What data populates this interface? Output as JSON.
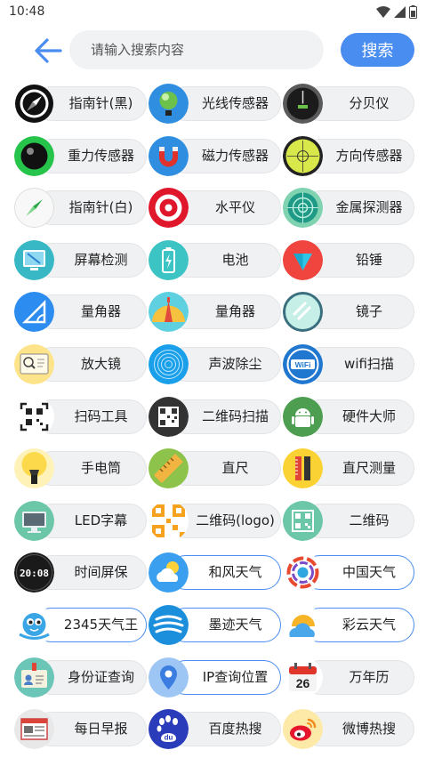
{
  "status": {
    "time": "10:48"
  },
  "search": {
    "placeholder": "请输入搜索内容",
    "value": "",
    "button_label": "搜索"
  },
  "colors": {
    "accent": "#4a8df0",
    "pill": "#f0f1f3"
  },
  "tools": [
    {
      "label": "指南针(黑)",
      "icon": "compass-black-icon"
    },
    {
      "label": "光线传感器",
      "icon": "light-sensor-icon"
    },
    {
      "label": "分贝仪",
      "icon": "decibel-meter-icon"
    },
    {
      "label": "重力传感器",
      "icon": "gravity-sensor-icon"
    },
    {
      "label": "磁力传感器",
      "icon": "magnet-icon"
    },
    {
      "label": "方向传感器",
      "icon": "orientation-sensor-icon"
    },
    {
      "label": "指南针(白)",
      "icon": "compass-white-icon"
    },
    {
      "label": "水平仪",
      "icon": "level-target-icon"
    },
    {
      "label": "金属探测器",
      "icon": "metal-detector-icon"
    },
    {
      "label": "屏幕检测",
      "icon": "screen-test-icon"
    },
    {
      "label": "电池",
      "icon": "battery-icon"
    },
    {
      "label": "铅锤",
      "icon": "plumb-bob-icon"
    },
    {
      "label": "量角器",
      "icon": "protractor-ruler-icon"
    },
    {
      "label": "量角器",
      "icon": "protractor-icon"
    },
    {
      "label": "镜子",
      "icon": "mirror-icon"
    },
    {
      "label": "放大镜",
      "icon": "magnifier-icon"
    },
    {
      "label": "声波除尘",
      "icon": "sound-wave-icon"
    },
    {
      "label": "wifi扫描",
      "icon": "wifi-icon"
    },
    {
      "label": "扫码工具",
      "icon": "scan-icon"
    },
    {
      "label": "二维码扫描",
      "icon": "qr-scan-icon"
    },
    {
      "label": "硬件大师",
      "icon": "android-icon"
    },
    {
      "label": "手电筒",
      "icon": "flashlight-icon"
    },
    {
      "label": "直尺",
      "icon": "ruler-icon"
    },
    {
      "label": "直尺测量",
      "icon": "ruler-measure-icon"
    },
    {
      "label": "LED字幕",
      "icon": "led-monitor-icon"
    },
    {
      "label": "二维码(logo)",
      "icon": "qr-logo-icon"
    },
    {
      "label": "二维码",
      "icon": "qr-code-icon"
    },
    {
      "label": "时间屏保",
      "icon": "clock-screensaver-icon"
    },
    {
      "label": "和风天气",
      "icon": "weather-sun-cloud-icon"
    },
    {
      "label": "中国天气",
      "icon": "china-weather-icon"
    },
    {
      "label": "2345天气王",
      "icon": "weather-mascot-icon"
    },
    {
      "label": "墨迹天气",
      "icon": "moji-weather-icon"
    },
    {
      "label": "彩云天气",
      "icon": "caiyun-weather-icon"
    },
    {
      "label": "身份证查询",
      "icon": "id-card-icon"
    },
    {
      "label": "IP查询位置",
      "icon": "location-pin-icon"
    },
    {
      "label": "万年历",
      "icon": "calendar-icon"
    },
    {
      "label": "每日早报",
      "icon": "newspaper-icon"
    },
    {
      "label": "百度热搜",
      "icon": "baidu-icon"
    },
    {
      "label": "微博热搜",
      "icon": "weibo-icon"
    }
  ],
  "calendar_day": "26",
  "clock_time": "20:08"
}
